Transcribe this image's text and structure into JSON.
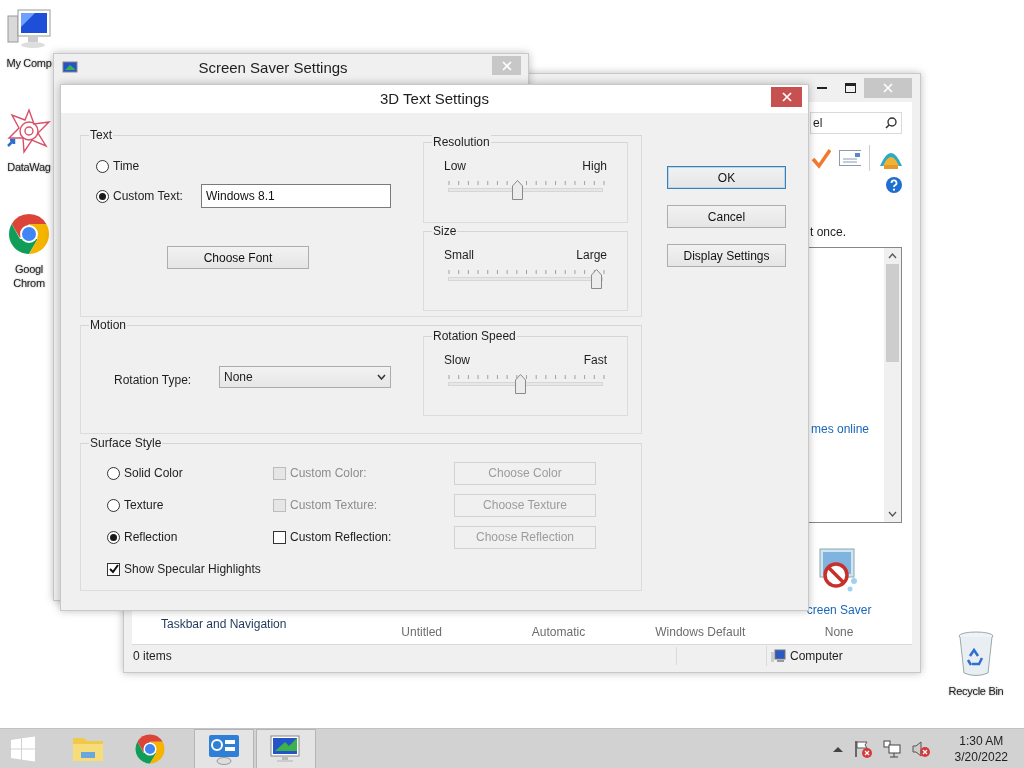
{
  "desktop_icons": [
    {
      "kind": "computer",
      "label": "My Comp"
    },
    {
      "kind": "datawag",
      "label": "DataWag"
    },
    {
      "kind": "chrome",
      "label": "Googl Chrom"
    },
    {
      "kind": "recycle",
      "label": "Recycle Bin"
    }
  ],
  "background_window": {
    "search": {
      "value": "el"
    },
    "description": "t once.",
    "theme_link": "mes online",
    "settings_row": [
      {
        "kind": "link",
        "text": "Taskbar and Navigation"
      },
      {
        "kind": "value",
        "text": "Untitled"
      },
      {
        "kind": "value",
        "text": "Automatic"
      },
      {
        "kind": "value",
        "text": "Windows Default"
      },
      {
        "kind": "screensaver",
        "title": "creen Saver",
        "value": "None"
      }
    ],
    "status_bar": [
      "0 items",
      "Computer"
    ]
  },
  "screen_saver_window": {
    "title": "Screen Saver Settings"
  },
  "dialog": {
    "title": "3D Text Settings",
    "text_group": {
      "title": "Text",
      "options": [
        {
          "label": "Time",
          "selected": false
        },
        {
          "label": "Custom Text:",
          "selected": true
        }
      ],
      "custom_text": {
        "value": "Windows 8.1"
      },
      "font_button": "Choose Font"
    },
    "resolution": {
      "title": "Resolution",
      "min_label": "Low",
      "max_label": "High",
      "level": 0.45
    },
    "size": {
      "title": "Size",
      "min_label": "Small",
      "max_label": "Large",
      "level": 0.97
    },
    "motion": {
      "title": "Motion",
      "rotation_label": "Rotation Type:",
      "rotation_value": "None"
    },
    "rotation_speed": {
      "title": "Rotation Speed",
      "min_label": "Slow",
      "max_label": "Fast",
      "level": 0.47
    },
    "surface": {
      "title": "Surface Style",
      "rows": [
        {
          "label": "Solid Color",
          "selected": false,
          "custom_label": "Custom Color:",
          "custom_checked": false,
          "custom_disabled": true,
          "button": "Choose Color",
          "button_disabled": true
        },
        {
          "label": "Texture",
          "selected": false,
          "custom_label": "Custom Texture:",
          "custom_checked": false,
          "custom_disabled": true,
          "button": "Choose Texture",
          "button_disabled": true
        },
        {
          "label": "Reflection",
          "selected": true,
          "custom_label": "Custom Reflection:",
          "custom_checked": false,
          "custom_disabled": false,
          "button": "Choose Reflection",
          "button_disabled": true
        }
      ],
      "specular": {
        "label": "Show Specular Highlights",
        "checked": true
      }
    },
    "buttons": [
      {
        "label": "OK",
        "default": true
      },
      {
        "label": "Cancel",
        "default": false
      },
      {
        "label": "Display Settings",
        "default": false
      }
    ]
  },
  "taskbar": {
    "apps": [
      {
        "kind": "start",
        "active": false
      },
      {
        "kind": "explorer",
        "active": false
      },
      {
        "kind": "chrome",
        "active": false
      },
      {
        "kind": "controlpanel",
        "active": true
      },
      {
        "kind": "screensaver",
        "active": true
      }
    ],
    "time": "1:30 AM",
    "date": "3/20/2022"
  }
}
